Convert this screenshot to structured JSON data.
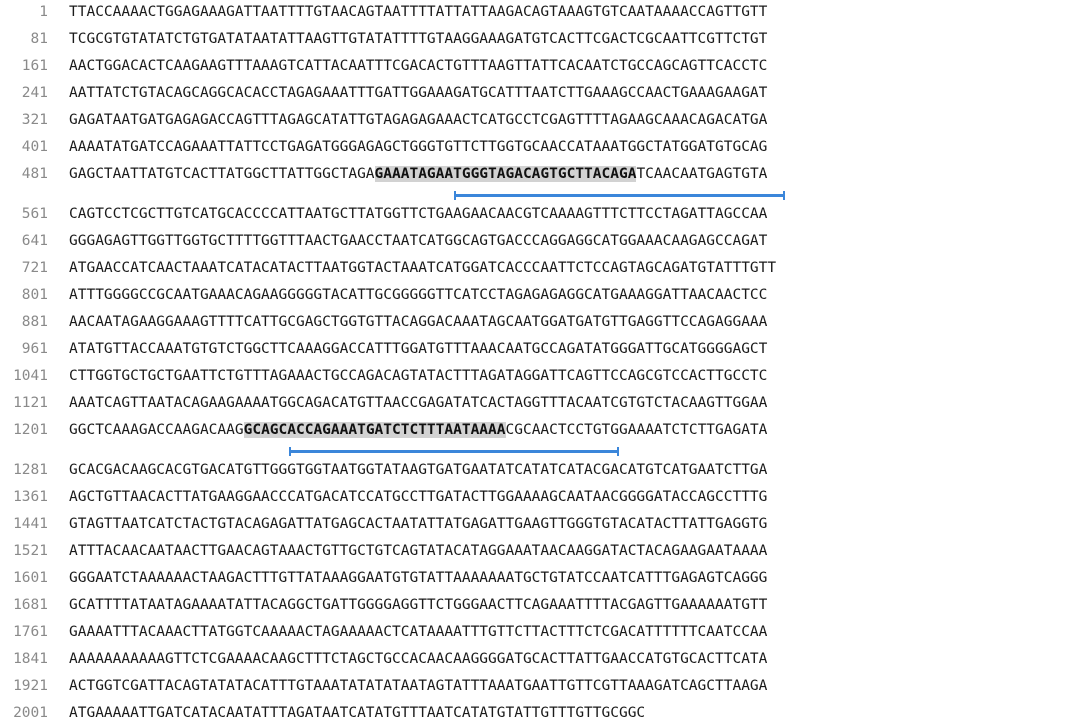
{
  "accent_color": "#3b86da",
  "highlight_color": "#d2d2d2",
  "rows": [
    {
      "pos": "1",
      "seq": "TTACCAAAACTGGAGAAAGATTAATTTTGTAACAGTAATTTTATTATTAAGACAGTAAAGTGTCAATAAAACCAGTTGTT"
    },
    {
      "pos": "81",
      "seq": "TCGCGTGTATATCTGTGATATAATATTAAGTTGTATATTTTGTAAGGAAAGATGTCACTTCGACTCGCAATTCGTTCTGT"
    },
    {
      "pos": "161",
      "seq": "AACTGGACACTCAAGAAGTTTAAAGTCATTACAATTTCGACACTGTTTAAGTTATTCACAATCTGCCAGCAGTTCACCTC"
    },
    {
      "pos": "241",
      "seq": "AATTATCTGTACAGCAGGCACACCTAGAGAAATTTGATTGGAAAGATGCATTTAATCTTGAAAGCCAACTGAAAGAAGAT"
    },
    {
      "pos": "321",
      "seq": "GAGATAATGATGAGAGACCAGTTTAGAGCATATTGTAGAGAGAAACTCATGCCTCGAGTTTTAGAAGCAAACAGACATGA"
    },
    {
      "pos": "401",
      "seq": "AAAATATGATCCAGAAATTATTCCTGAGATGGGAGAGCTGGGTGTTCTTGGTGCAACCATAAATGGCTATGGATGTGCAG"
    },
    {
      "pos": "481",
      "pre": "GAGCTAATTATGTCACTTATGGCTTATTGGCTAGA",
      "hl": "GAAATAGAATGGGTAGACAGTGCTTACAGA",
      "post": "TCAACAATGAGTGTA"
    },
    {
      "pos": "561",
      "seq": "CAGTCCTCGCTTGTCATGCACCCCATTAATGCTTATGGTTCTGAAGAACAACGTCAAAAGTTTCTTCCTAGATTAGCCAA"
    },
    {
      "pos": "641",
      "seq": "GGGAGAGTTGGTTGGTGCTTTTGGTTTAACTGAACCTAATCATGGCAGTGACCCAGGAGGCATGGAAACAAGAGCCAGAT"
    },
    {
      "pos": "721",
      "seq": "ATGAACCATCAACTAAATCATACATACTTAATGGTACTAAATCATGGATCACCCAATTCTCCAGTAGCAGATGTATTTGTT"
    },
    {
      "pos": "801",
      "seq": "ATTTGGGGCCGCAATGAAACAGAAGGGGGTACATTGCGGGGGTTCATCCTAGAGAGAGGCATGAAAGGATTAACAACTCC"
    },
    {
      "pos": "881",
      "seq": "AACAATAGAAGGAAAGTTTTCATTGCGAGCTGGTGTTACAGGACAAATAGCAATGGATGATGTTGAGGTTCCAGAGGAAA"
    },
    {
      "pos": "961",
      "seq": "ATATGTTACCAAATGTGTCTGGCTTCAAAGGACCATTTGGATGTTTAAACAATGCCAGATATGGGATTGCATGGGGAGCT"
    },
    {
      "pos": "1041",
      "seq": "CTTGGTGCTGCTGAATTCTGTTTAGAAACTGCCAGACAGTATACTTTAGATAGGATTCAGTTCCAGCGTCCACTTGCCTC"
    },
    {
      "pos": "1121",
      "seq": "AAATCAGTTAATACAGAAGAAAATGGCAGACATGTTAACCGAGATATCACTAGGTTTACAATCGTGTCTACAAGTTGGAA"
    },
    {
      "pos": "1201",
      "pre": "GGCTCAAAGACCAAGACAAG",
      "hl": "GCAGCACCAGAAATGATCTCTTTAATAAAA",
      "post": "CGCAACTCCTGTGGAAAATCTCTTGAGATA"
    },
    {
      "pos": "1281",
      "seq": "GCACGACAAGCACGTGACATGTTGGGTGGTAATGGTATAAGTGATGAATATCATATCATACGACATGTCATGAATCTTGA"
    },
    {
      "pos": "1361",
      "seq": "AGCTGTTAACACTTATGAAGGAACCCATGACATCCATGCCTTGATACTTGGAAAAGCAATAACGGGGATACCAGCCTTTG"
    },
    {
      "pos": "1441",
      "seq": "GTAGTTAATCATCTACTGTACAGAGATTATGAGCACTAATATTATGAGATTGAAGTTGGGTGTACATACTTATTGAGGTG"
    },
    {
      "pos": "1521",
      "seq": "ATTTACAACAATAACTTGAACAGTAAACTGTTGCTGTCAGTATACATAGGAAATAACAAGGATACTACAGAAGAATAAAA"
    },
    {
      "pos": "1601",
      "seq": "GGGAATCTAAAAAACTAAGACTTTGTTATAAAGGAATGTGTATTAAAAAAATGCTGTATCCAATCATTTGAGAGTCAGGG"
    },
    {
      "pos": "1681",
      "seq": "GCATTTTATAATAGAAAATATTACAGGCTGATTGGGGAGGTTCTGGGAACTTCAGAAATTTTACGAGTTGAAAAAATGTT"
    },
    {
      "pos": "1761",
      "seq": "GAAAATTTACAAACTTATGGTCAAAAACTAGAAAAACTCATAAAATTTGTTCTTACTTTCTCGACATTTTTTCAATCCAA"
    },
    {
      "pos": "1841",
      "seq": "AAAAAAAAAAAGTTCTCGAAAACAAGCTTTCTAGCTGCCACAACAAGGGGATGCACTTATTGAACCATGTGCACTTCATA"
    },
    {
      "pos": "1921",
      "seq": "ACTGGTCGATTACAGTATATACATTTGTAAATATATATAATAGTATTTAAATGAATTGTTCGTTAAAGATCAGCTTAAGA"
    },
    {
      "pos": "2001",
      "seq": "ATGAAAAATTGATCATACAATATTTAGATAATCATATGTTTAATCATATGTATTGTTTGTTGCGGC"
    }
  ]
}
